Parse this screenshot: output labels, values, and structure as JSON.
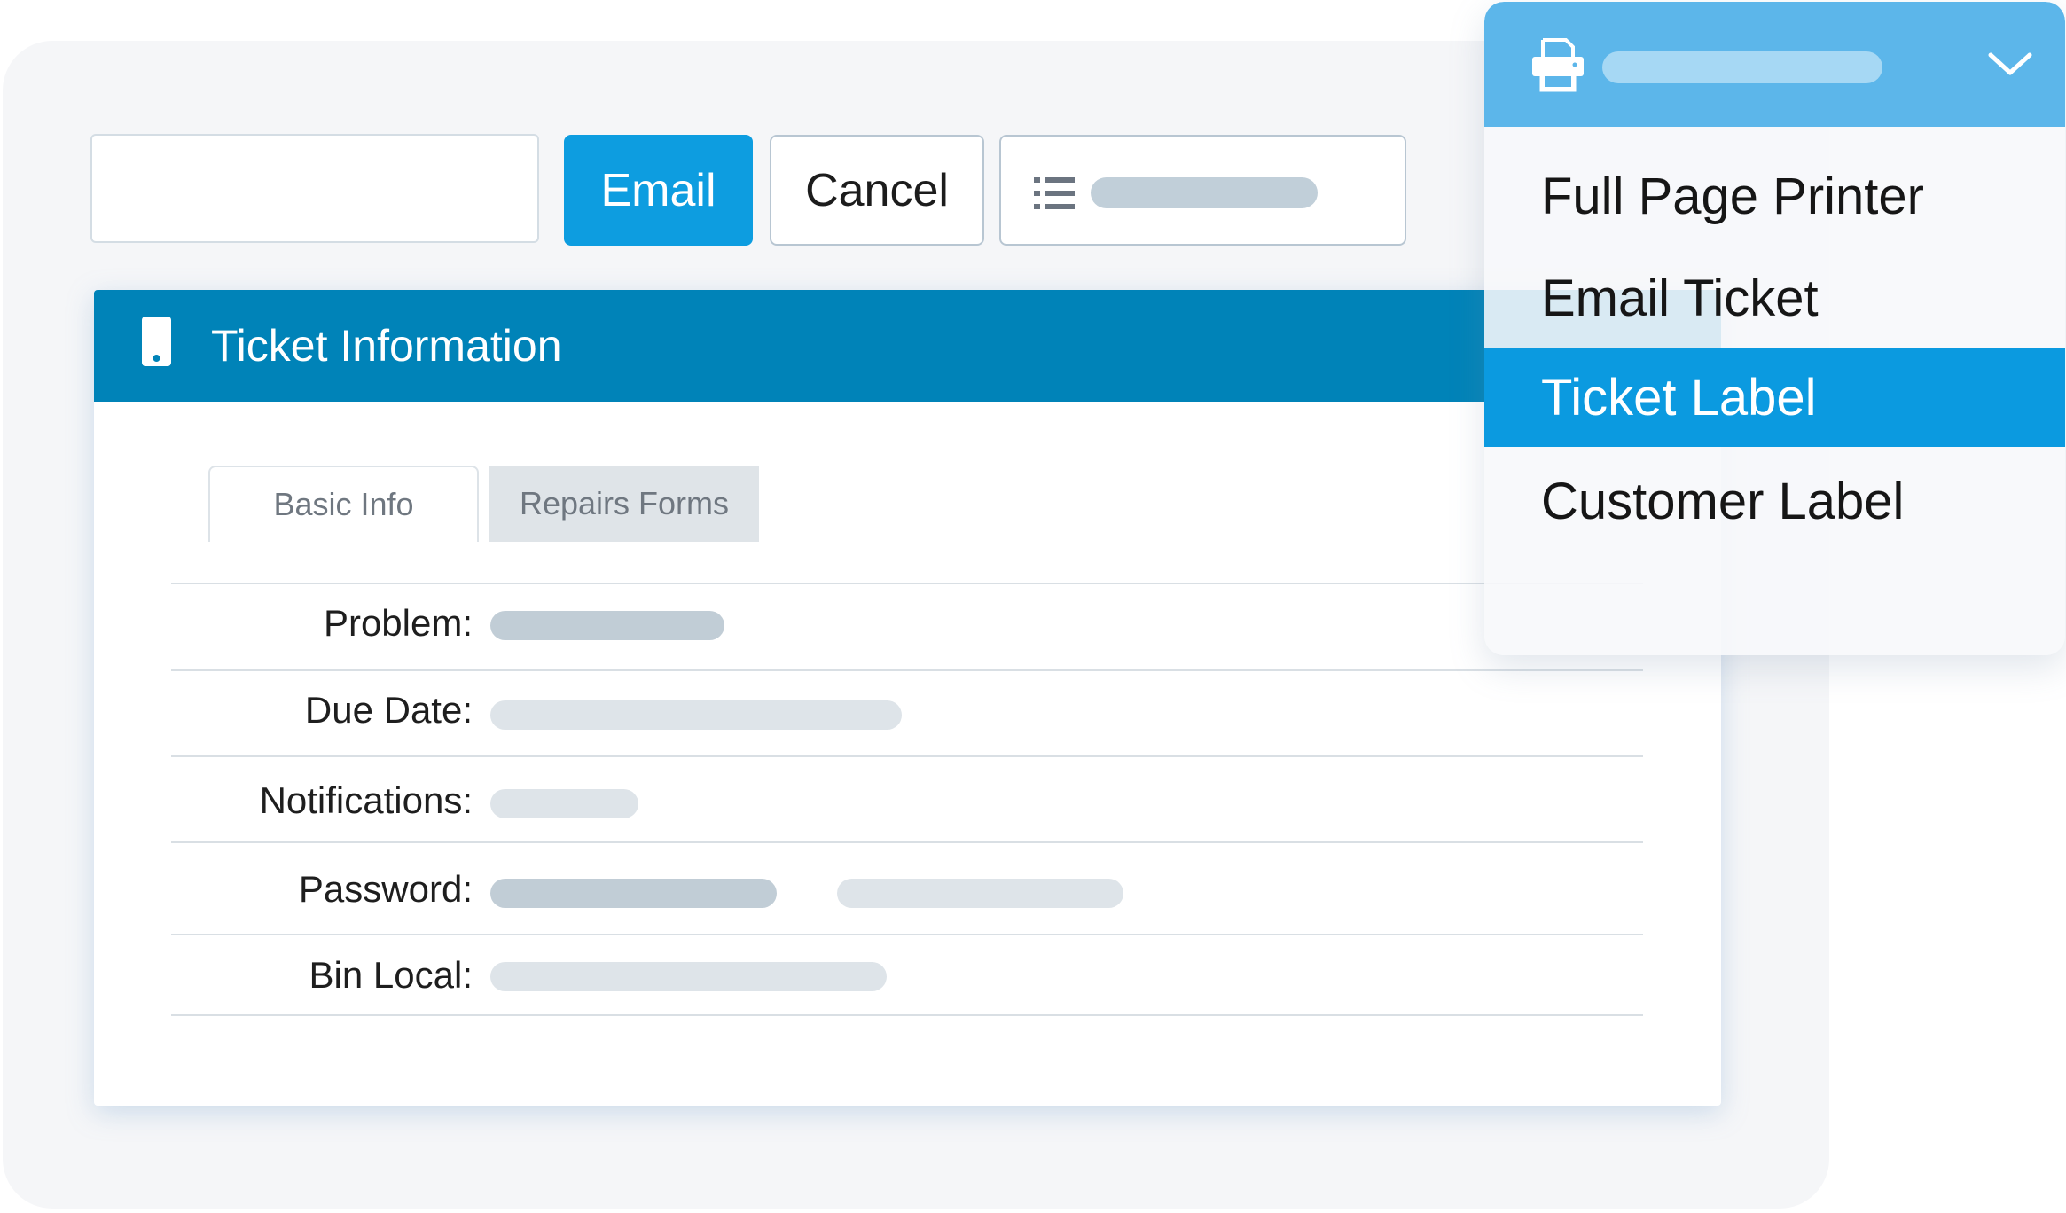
{
  "toolbar": {
    "search_value": "",
    "email_label": "Email",
    "cancel_label": "Cancel"
  },
  "ticket": {
    "title": "Ticket Information",
    "tabs": [
      {
        "label": "Basic Info",
        "active": true
      },
      {
        "label": "Repairs Forms",
        "active": false
      }
    ],
    "fields": [
      {
        "label": "Problem:"
      },
      {
        "label": "Due Date:"
      },
      {
        "label": "Notifications:"
      },
      {
        "label": "Password:"
      },
      {
        "label": "Bin Local:"
      }
    ]
  },
  "print_menu": {
    "items": [
      {
        "label": "Full Page Printer",
        "selected": false
      },
      {
        "label": "Email Ticket",
        "selected": false
      },
      {
        "label": "Ticket Label",
        "selected": true
      },
      {
        "label": "Customer Label",
        "selected": false
      }
    ]
  },
  "colors": {
    "primary": "#0d9de0",
    "header": "#0083b8",
    "dropdown_header": "#5cb6ea",
    "selected_item": "#0b9ae0"
  }
}
